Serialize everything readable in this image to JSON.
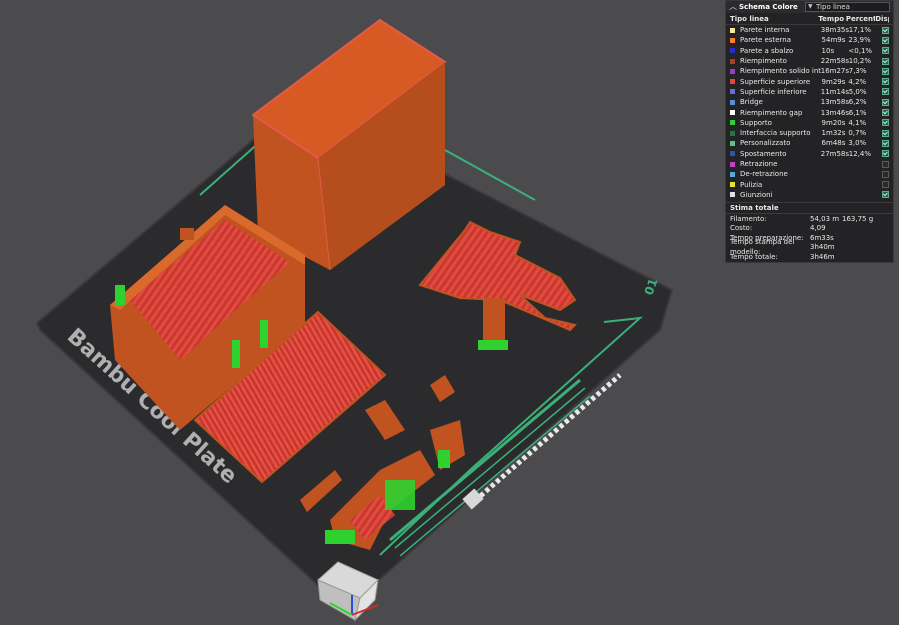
{
  "plate": {
    "label": "Bambu Cool Plate",
    "number": "01",
    "colors": {
      "bed": "#2a2a2c",
      "trim": "#3bb078",
      "part_wall": "#c0531f",
      "part_fill": "#d13c32",
      "support": "#2fd12f"
    }
  },
  "legend": {
    "title": "Schema Colore",
    "view_select": "Tipo linea",
    "columns": {
      "name": "Tipo linea",
      "time": "Tempo",
      "percent": "Percentuale",
      "display": "Display"
    },
    "rows": [
      {
        "name": "Parete interna",
        "time": "38m35s",
        "percent": "17,1%",
        "color": "#f2e9a0",
        "checked": true
      },
      {
        "name": "Parete esterna",
        "time": "54m9s",
        "percent": "23,9%",
        "color": "#ff7c2a",
        "checked": true
      },
      {
        "name": "Parete a sbalzo",
        "time": "10s",
        "percent": "<0,1%",
        "color": "#2a2ac8",
        "checked": true
      },
      {
        "name": "Riempimento",
        "time": "22m58s",
        "percent": "10,2%",
        "color": "#b03a2e",
        "checked": true
      },
      {
        "name": "Riempimento solido interno",
        "time": "16m27s",
        "percent": "7,3%",
        "color": "#9a3ec2",
        "checked": true
      },
      {
        "name": "Superficie superiore",
        "time": "9m29s",
        "percent": "4,2%",
        "color": "#e0493a",
        "checked": true
      },
      {
        "name": "Superficie inferiore",
        "time": "11m14s",
        "percent": "5,0%",
        "color": "#6e6ad4",
        "checked": true
      },
      {
        "name": "Bridge",
        "time": "13m58s",
        "percent": "6,2%",
        "color": "#5c8fd0",
        "checked": true
      },
      {
        "name": "Riempimento gap",
        "time": "13m46s",
        "percent": "6,1%",
        "color": "#ffffff",
        "checked": true
      },
      {
        "name": "Supporto",
        "time": "9m20s",
        "percent": "4,1%",
        "color": "#33cc33",
        "checked": true
      },
      {
        "name": "Interfaccia supporto",
        "time": "1m32s",
        "percent": "0,7%",
        "color": "#1f7a3a",
        "checked": true
      },
      {
        "name": "Personalizzato",
        "time": "6m48s",
        "percent": "3,0%",
        "color": "#5ebf8a",
        "checked": true
      },
      {
        "name": "Spostamento",
        "time": "27m58s",
        "percent": "12,4%",
        "color": "#2a5aa0",
        "checked": true
      },
      {
        "name": "Retrazione",
        "time": "",
        "percent": "",
        "color": "#c53fc5",
        "checked": false
      },
      {
        "name": "De-retrazione",
        "time": "",
        "percent": "",
        "color": "#55aadd",
        "checked": false
      },
      {
        "name": "Pulizia",
        "time": "",
        "percent": "",
        "color": "#e6e23a",
        "checked": false
      },
      {
        "name": "Giunzioni",
        "time": "",
        "percent": "",
        "color": "#e0e0e0",
        "checked": true
      }
    ],
    "summary_title": "Stima totale",
    "summary": [
      {
        "key": "Filamento:",
        "v1": "54,03 m",
        "v2": "163,75 g"
      },
      {
        "key": "Costo:",
        "v1": "4,09",
        "v2": ""
      },
      {
        "key": "Tempo preparazione:",
        "v1": "6m33s",
        "v2": ""
      },
      {
        "key": "Tempo stampa del modello:",
        "v1": "3h40m",
        "v2": ""
      },
      {
        "key": "Tempo totale:",
        "v1": "3h46m",
        "v2": ""
      }
    ]
  }
}
